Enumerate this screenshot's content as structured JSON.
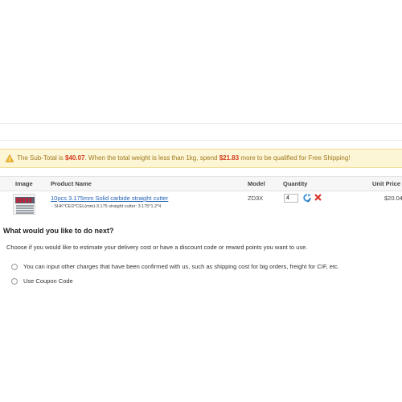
{
  "notice": {
    "prefix": "The Sub-Total is ",
    "subtotal": "$40.07",
    "middle": ". When the total weight is less than 1kg, spend ",
    "spend_amount": "$21.83",
    "suffix": " more to be qualified for Free Shipping!"
  },
  "cart": {
    "headers": {
      "image": "Image",
      "product_name": "Product Name",
      "model": "Model",
      "quantity": "Quantity",
      "unit_price": "Unit Price"
    },
    "items": [
      {
        "name": "10pcs 3.175mm Solid carbide straight cutter",
        "option": "- SHK*CED*CEL(mm)-3.175 straight cutter: 3.175*1.2*4",
        "model": "ZD3X",
        "quantity": "4",
        "unit_price": "$20.04"
      }
    ]
  },
  "next": {
    "title": "What would you like to do next?",
    "description": "Choose if you would like to estimate your delivery cost or have a discount code or reward points you want to use.",
    "options": [
      {
        "label": "You can input other charges that have been confirmed with us, such as shipping cost for big orders, freight for CIF, etc."
      },
      {
        "label": "Use Coupon Code"
      }
    ]
  },
  "colors": {
    "notice_bg": "#fcf5d6",
    "notice_text": "#a07a1e",
    "amount": "#d23a1a",
    "link": "#2462b5"
  },
  "icons": {
    "notice": "warning-icon",
    "update": "refresh-icon",
    "remove": "remove-icon"
  }
}
